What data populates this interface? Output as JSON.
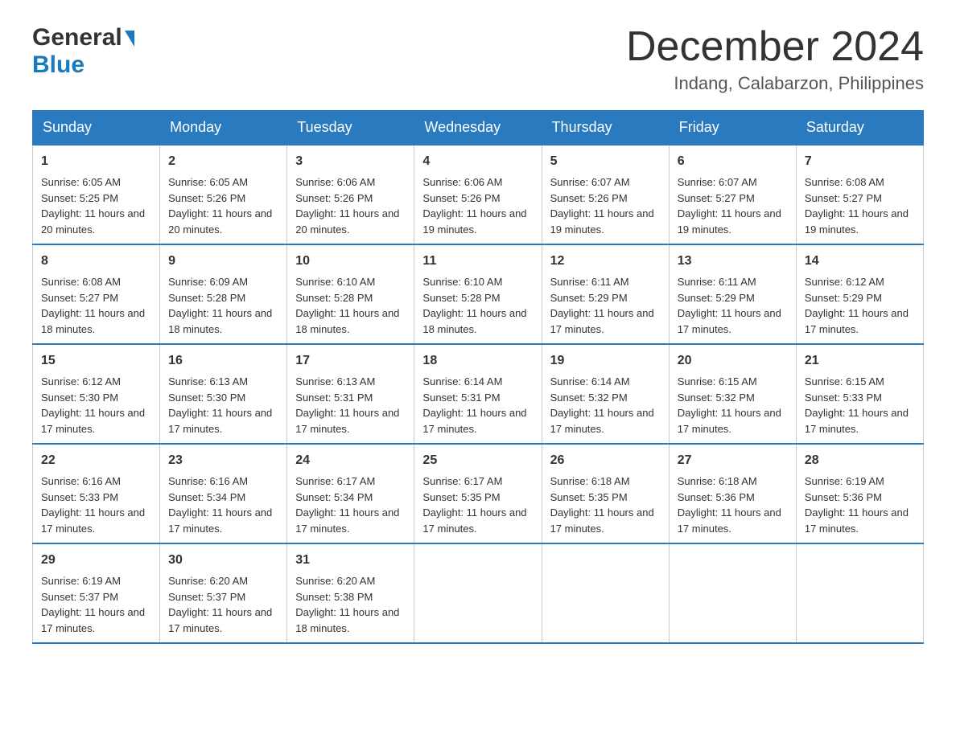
{
  "header": {
    "logo_general": "General",
    "logo_blue": "Blue",
    "month_title": "December 2024",
    "location": "Indang, Calabarzon, Philippines"
  },
  "days_of_week": [
    "Sunday",
    "Monday",
    "Tuesday",
    "Wednesday",
    "Thursday",
    "Friday",
    "Saturday"
  ],
  "weeks": [
    [
      {
        "day": "1",
        "sunrise": "6:05 AM",
        "sunset": "5:25 PM",
        "daylight": "11 hours and 20 minutes."
      },
      {
        "day": "2",
        "sunrise": "6:05 AM",
        "sunset": "5:26 PM",
        "daylight": "11 hours and 20 minutes."
      },
      {
        "day": "3",
        "sunrise": "6:06 AM",
        "sunset": "5:26 PM",
        "daylight": "11 hours and 20 minutes."
      },
      {
        "day": "4",
        "sunrise": "6:06 AM",
        "sunset": "5:26 PM",
        "daylight": "11 hours and 19 minutes."
      },
      {
        "day": "5",
        "sunrise": "6:07 AM",
        "sunset": "5:26 PM",
        "daylight": "11 hours and 19 minutes."
      },
      {
        "day": "6",
        "sunrise": "6:07 AM",
        "sunset": "5:27 PM",
        "daylight": "11 hours and 19 minutes."
      },
      {
        "day": "7",
        "sunrise": "6:08 AM",
        "sunset": "5:27 PM",
        "daylight": "11 hours and 19 minutes."
      }
    ],
    [
      {
        "day": "8",
        "sunrise": "6:08 AM",
        "sunset": "5:27 PM",
        "daylight": "11 hours and 18 minutes."
      },
      {
        "day": "9",
        "sunrise": "6:09 AM",
        "sunset": "5:28 PM",
        "daylight": "11 hours and 18 minutes."
      },
      {
        "day": "10",
        "sunrise": "6:10 AM",
        "sunset": "5:28 PM",
        "daylight": "11 hours and 18 minutes."
      },
      {
        "day": "11",
        "sunrise": "6:10 AM",
        "sunset": "5:28 PM",
        "daylight": "11 hours and 18 minutes."
      },
      {
        "day": "12",
        "sunrise": "6:11 AM",
        "sunset": "5:29 PM",
        "daylight": "11 hours and 17 minutes."
      },
      {
        "day": "13",
        "sunrise": "6:11 AM",
        "sunset": "5:29 PM",
        "daylight": "11 hours and 17 minutes."
      },
      {
        "day": "14",
        "sunrise": "6:12 AM",
        "sunset": "5:29 PM",
        "daylight": "11 hours and 17 minutes."
      }
    ],
    [
      {
        "day": "15",
        "sunrise": "6:12 AM",
        "sunset": "5:30 PM",
        "daylight": "11 hours and 17 minutes."
      },
      {
        "day": "16",
        "sunrise": "6:13 AM",
        "sunset": "5:30 PM",
        "daylight": "11 hours and 17 minutes."
      },
      {
        "day": "17",
        "sunrise": "6:13 AM",
        "sunset": "5:31 PM",
        "daylight": "11 hours and 17 minutes."
      },
      {
        "day": "18",
        "sunrise": "6:14 AM",
        "sunset": "5:31 PM",
        "daylight": "11 hours and 17 minutes."
      },
      {
        "day": "19",
        "sunrise": "6:14 AM",
        "sunset": "5:32 PM",
        "daylight": "11 hours and 17 minutes."
      },
      {
        "day": "20",
        "sunrise": "6:15 AM",
        "sunset": "5:32 PM",
        "daylight": "11 hours and 17 minutes."
      },
      {
        "day": "21",
        "sunrise": "6:15 AM",
        "sunset": "5:33 PM",
        "daylight": "11 hours and 17 minutes."
      }
    ],
    [
      {
        "day": "22",
        "sunrise": "6:16 AM",
        "sunset": "5:33 PM",
        "daylight": "11 hours and 17 minutes."
      },
      {
        "day": "23",
        "sunrise": "6:16 AM",
        "sunset": "5:34 PM",
        "daylight": "11 hours and 17 minutes."
      },
      {
        "day": "24",
        "sunrise": "6:17 AM",
        "sunset": "5:34 PM",
        "daylight": "11 hours and 17 minutes."
      },
      {
        "day": "25",
        "sunrise": "6:17 AM",
        "sunset": "5:35 PM",
        "daylight": "11 hours and 17 minutes."
      },
      {
        "day": "26",
        "sunrise": "6:18 AM",
        "sunset": "5:35 PM",
        "daylight": "11 hours and 17 minutes."
      },
      {
        "day": "27",
        "sunrise": "6:18 AM",
        "sunset": "5:36 PM",
        "daylight": "11 hours and 17 minutes."
      },
      {
        "day": "28",
        "sunrise": "6:19 AM",
        "sunset": "5:36 PM",
        "daylight": "11 hours and 17 minutes."
      }
    ],
    [
      {
        "day": "29",
        "sunrise": "6:19 AM",
        "sunset": "5:37 PM",
        "daylight": "11 hours and 17 minutes."
      },
      {
        "day": "30",
        "sunrise": "6:20 AM",
        "sunset": "5:37 PM",
        "daylight": "11 hours and 17 minutes."
      },
      {
        "day": "31",
        "sunrise": "6:20 AM",
        "sunset": "5:38 PM",
        "daylight": "11 hours and 18 minutes."
      },
      null,
      null,
      null,
      null
    ]
  ],
  "labels": {
    "sunrise": "Sunrise:",
    "sunset": "Sunset:",
    "daylight": "Daylight:"
  }
}
